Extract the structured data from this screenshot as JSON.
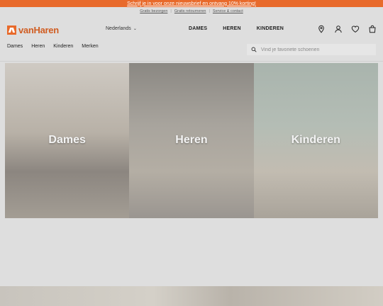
{
  "promo": {
    "text": "Schrijf je in voor onze nieuwsbrief en ontvang 10% korting!"
  },
  "utility_links": [
    "Gratis bezorgen",
    "Gratis retourneren",
    "Service & contact"
  ],
  "brand": {
    "name": "vanHaren",
    "accent": "#e86a2b"
  },
  "language": {
    "label": "Nederlands"
  },
  "main_nav": [
    "DAMES",
    "HEREN",
    "KINDEREN"
  ],
  "header_icons": [
    "location-icon",
    "account-icon",
    "wishlist-heart-icon",
    "shopping-bag-icon"
  ],
  "sub_nav": [
    "Dames",
    "Heren",
    "Kinderen",
    "Merken"
  ],
  "search": {
    "placeholder": "Vind je favoriete schoenen"
  },
  "category_tiles": [
    {
      "label": "Dames"
    },
    {
      "label": "Heren"
    },
    {
      "label": "Kinderen"
    }
  ]
}
